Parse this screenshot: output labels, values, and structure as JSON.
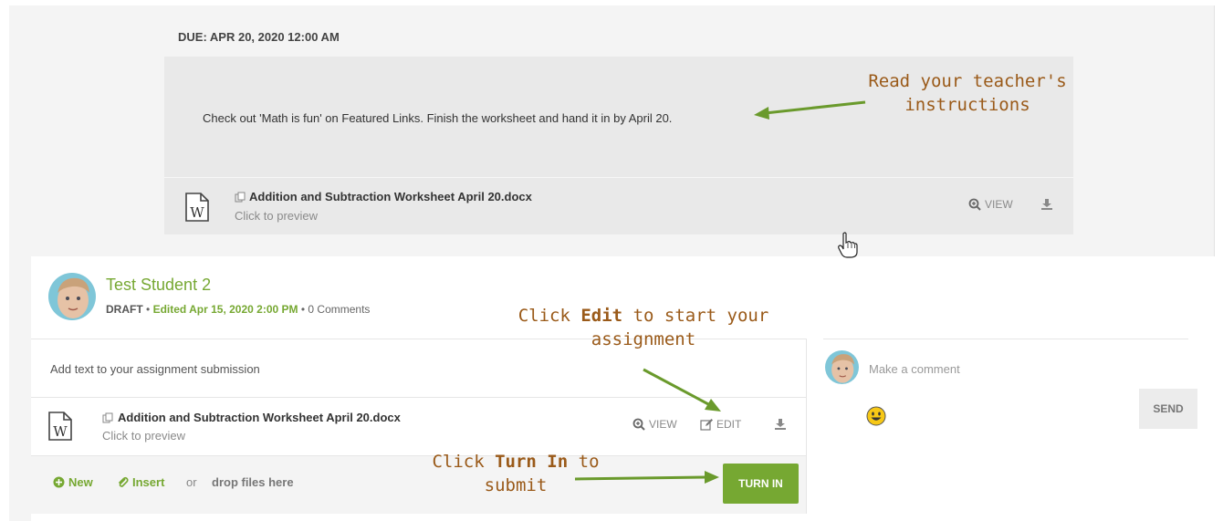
{
  "assignment": {
    "due": "DUE: APR 20, 2020 12:00 AM",
    "instructions": "Check out 'Math is fun' on Featured Links.  Finish the worksheet and hand it in by April 20.",
    "attachment": {
      "name": "Addition and Subtraction Worksheet April 20.docx",
      "subtitle": "Click to preview",
      "view_label": "VIEW"
    }
  },
  "student": {
    "name": "Test Student 2",
    "status": "DRAFT",
    "separator": "•",
    "edited": "Edited Apr 15, 2020 2:00 PM",
    "comments": "0 Comments"
  },
  "submission": {
    "placeholder": "Add text to your assignment submission",
    "attachment": {
      "name": "Addition and Subtraction Worksheet April 20.docx",
      "subtitle": "Click to preview",
      "view_label": "VIEW",
      "edit_label": "EDIT"
    },
    "footer": {
      "new_label": "New",
      "insert_label": "Insert",
      "or_label": "or",
      "drop_label": "drop files here",
      "turn_in_label": "TURN IN"
    }
  },
  "comments": {
    "placeholder": "Make a comment",
    "send_label": "SEND"
  },
  "annotations": {
    "read_line1": "Read your teacher's",
    "read_line2": "instructions",
    "edit_pre": "Click ",
    "edit_bold": "Edit",
    "edit_post": " to start your",
    "edit_line2": "assignment",
    "turn_pre": "Click ",
    "turn_bold": "Turn In",
    "turn_post": " to",
    "turn_line2": "submit"
  },
  "colors": {
    "accent": "#76a832",
    "annotation": "#9a5a19",
    "arrow": "#6a9a2c"
  },
  "icons": [
    "word-doc-icon",
    "copy-icon",
    "zoom-icon",
    "download-icon",
    "edit-icon",
    "plus-circle-icon",
    "paperclip-icon",
    "smiley-icon",
    "hand-cursor-icon"
  ]
}
